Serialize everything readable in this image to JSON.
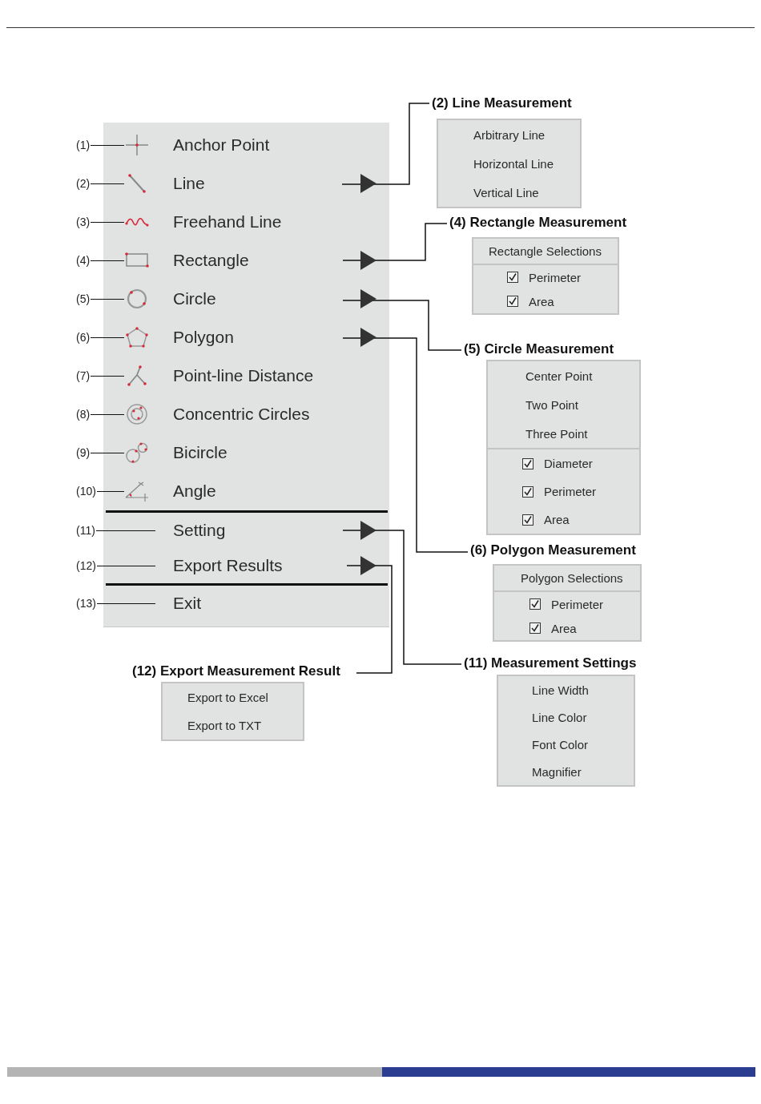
{
  "menu": {
    "sections": [
      {
        "items": [
          {
            "callout": "(1)",
            "label": "Anchor Point",
            "kind": "tool",
            "submenu": false
          },
          {
            "callout": "(2)",
            "label": "Line",
            "kind": "tool",
            "submenu": true
          },
          {
            "callout": "(3)",
            "label": "Freehand Line",
            "kind": "tool",
            "submenu": false
          },
          {
            "callout": "(4)",
            "label": "Rectangle",
            "kind": "tool",
            "submenu": true
          },
          {
            "callout": "(5)",
            "label": "Circle",
            "kind": "tool",
            "submenu": true
          },
          {
            "callout": "(6)",
            "label": "Polygon",
            "kind": "tool",
            "submenu": true
          },
          {
            "callout": "(7)",
            "label": "Point-line Distance",
            "kind": "tool",
            "submenu": false
          },
          {
            "callout": "(8)",
            "label": "Concentric Circles",
            "kind": "tool",
            "submenu": false
          },
          {
            "callout": "(9)",
            "label": "Bicircle",
            "kind": "tool",
            "submenu": false
          },
          {
            "callout": "(10)",
            "label": "Angle",
            "kind": "tool",
            "submenu": false
          }
        ]
      },
      {
        "items": [
          {
            "callout": "(11)",
            "label": "Setting",
            "kind": "command",
            "submenu": true
          },
          {
            "callout": "(12)",
            "label": "Export Results",
            "kind": "command",
            "submenu": true
          }
        ]
      },
      {
        "items": [
          {
            "callout": "(13)",
            "label": "Exit",
            "kind": "command",
            "submenu": false
          }
        ]
      }
    ]
  },
  "submenus": [
    {
      "title": "(2) Line Measurement",
      "groups": [
        {
          "kind": "plain",
          "items": [
            {
              "label": "Arbitrary Line"
            },
            {
              "label": "Horizontal Line"
            },
            {
              "label": "Vertical Line"
            }
          ]
        }
      ]
    },
    {
      "title": "(4) Rectangle Measurement",
      "groups": [
        {
          "kind": "plain",
          "items": [
            {
              "label": "Rectangle Selections"
            }
          ]
        },
        {
          "kind": "check",
          "items": [
            {
              "label": "Perimeter",
              "checked": true
            },
            {
              "label": "Area",
              "checked": true
            }
          ]
        }
      ]
    },
    {
      "title": "(5) Circle Measurement",
      "groups": [
        {
          "kind": "plain",
          "items": [
            {
              "label": "Center Point"
            },
            {
              "label": "Two Point"
            },
            {
              "label": "Three Point"
            }
          ]
        },
        {
          "kind": "check",
          "items": [
            {
              "label": "Diameter",
              "checked": true
            },
            {
              "label": "Perimeter",
              "checked": true
            },
            {
              "label": "Area",
              "checked": true
            }
          ]
        }
      ]
    },
    {
      "title": "(6) Polygon Measurement",
      "groups": [
        {
          "kind": "plain",
          "items": [
            {
              "label": "Polygon Selections"
            }
          ]
        },
        {
          "kind": "check",
          "items": [
            {
              "label": "Perimeter",
              "checked": true
            },
            {
              "label": "Area",
              "checked": true
            }
          ]
        }
      ]
    },
    {
      "title": "(11) Measurement Settings",
      "groups": [
        {
          "kind": "plain",
          "items": [
            {
              "label": "Line Width"
            },
            {
              "label": "Line Color"
            },
            {
              "label": "Font Color"
            },
            {
              "label": "Magnifier"
            }
          ]
        }
      ]
    },
    {
      "title": "(12) Export Measurement Result",
      "groups": [
        {
          "kind": "plain",
          "items": [
            {
              "label": "Export to Excel"
            },
            {
              "label": "Export to TXT"
            }
          ]
        }
      ]
    }
  ]
}
